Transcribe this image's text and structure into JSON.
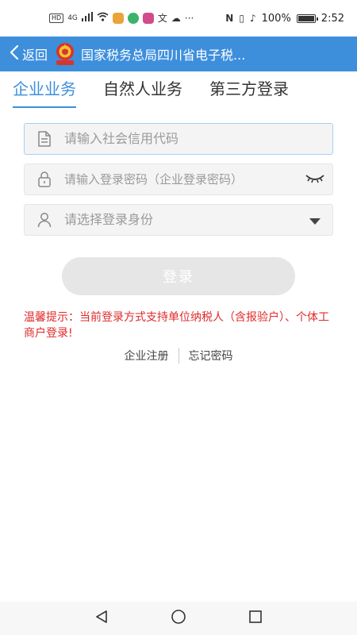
{
  "status_bar": {
    "left_indicators": [
      "HD",
      "4G"
    ],
    "battery_percent": "100%",
    "battery_level": 1.0,
    "time": "2:52",
    "more_glyph": "···"
  },
  "header": {
    "back_label": "返回",
    "title": "国家税务总局四川省电子税..."
  },
  "tabs": [
    {
      "label": "企业业务",
      "active": true
    },
    {
      "label": "自然人业务",
      "active": false
    },
    {
      "label": "第三方登录",
      "active": false
    }
  ],
  "form": {
    "credit_code_placeholder": "请输入社会信用代码",
    "password_placeholder": "请输入登录密码（企业登录密码）",
    "identity_placeholder": "请选择登录身份",
    "login_label": "登录"
  },
  "tip": {
    "text": "温馨提示：当前登录方式支持单位纳税人（含报验户）、个体工商户登录!"
  },
  "links": {
    "register": "企业注册",
    "forgot_password": "忘记密码"
  },
  "colors": {
    "brand": "#3d8fdc",
    "tip": "#e02a2a",
    "disabled_button": "#e6e6e6"
  },
  "icons": {
    "credit_field": "document-icon",
    "password_field": "lock-icon",
    "identity_field": "user-icon",
    "password_toggle": "eye-closed-icon",
    "dropdown": "caret-down-icon"
  }
}
